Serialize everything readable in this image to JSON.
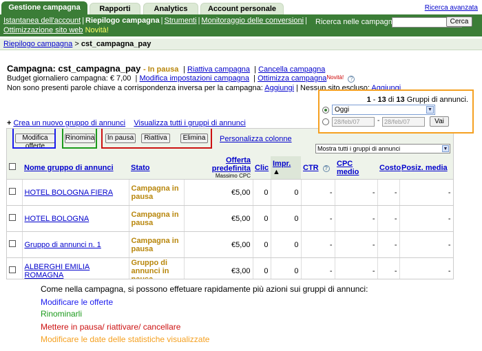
{
  "tabs": [
    {
      "label": "Gestione campagna",
      "active": true
    },
    {
      "label": "Rapporti",
      "active": false
    },
    {
      "label": "Analytics",
      "active": false
    },
    {
      "label": "Account personale",
      "active": false
    }
  ],
  "advanced_search": "Ricerca avanzata",
  "subnav": {
    "item1": "Istantanea dell'account",
    "item2": "Riepilogo campagna",
    "item3": "Strumenti",
    "item4": "Monitoraggio delle conversioni",
    "item5": "Ottimizzazione sito web",
    "new_badge": "Novità!"
  },
  "search": {
    "label": "Ricerca nelle campagne:",
    "value": "",
    "button": "Cerca"
  },
  "breadcrumb": {
    "link": "Riepilogo campagna",
    "separator": ">",
    "current": "cst_campagna_pay"
  },
  "campaign": {
    "title": "Campagna: cst_campagna_pay",
    "status": "- In pausa",
    "links": [
      "Riattiva campagna",
      "Cancella campagna"
    ],
    "budget_label": "Budget giornaliero campagna: € 7,00",
    "budget_links": [
      "Modifica impostazioni campagna",
      "Ottimizza campagna"
    ],
    "novita": "Novità!",
    "kw_text": "Non sono presenti parole chiave a corrispondenza inversa per la campagna:",
    "kw_link": "Aggiungi",
    "site_text": "Nessun sito escluso:",
    "site_link": "Aggiungi"
  },
  "create_links": {
    "plus": "+",
    "create": "Crea un nuovo gruppo di annunci",
    "view_all": "Visualizza tutti i gruppi di annunci"
  },
  "date_box": {
    "count_from": "1",
    "count_to": "13",
    "count_total": "13",
    "count_suffix": "Gruppi di annunci.",
    "range_selected": "Oggi",
    "date_from": "28/feb/07",
    "date_dash": "-",
    "date_to": "28/feb/07",
    "go_button": "Vai"
  },
  "toolbar": {
    "edit_bids": "Modifica offerte",
    "rename": "Rinomina",
    "pause": "In pausa",
    "resume": "Riattiva",
    "delete": "Elimina",
    "customize": "Personalizza colonne",
    "show_filter": "Mostra tutti i gruppi di annunci"
  },
  "columns": {
    "name": "Nome gruppo di annunci",
    "status": "Stato",
    "bid": "Offerta predefinita",
    "bid_sub": "Massimo CPC",
    "clicks": "Clic",
    "impr": "Impr.",
    "ctr": "CTR",
    "avg_cpc": "CPC medio",
    "cost": "Costo",
    "avg_pos": "Posiz. media"
  },
  "rows": [
    {
      "name": "HOTEL BOLOGNA FIERA",
      "status": "Campagna in pausa",
      "bid": "€5,00",
      "clicks": "0",
      "impr": "0",
      "ctr": "-",
      "cpc": "-",
      "cost": "-",
      "pos": "-"
    },
    {
      "name": "HOTEL BOLOGNA",
      "status": "Campagna in pausa",
      "bid": "€5,00",
      "clicks": "0",
      "impr": "0",
      "ctr": "-",
      "cpc": "-",
      "cost": "-",
      "pos": "-"
    },
    {
      "name": "Gruppo di annunci n. 1",
      "status": "Campagna in pausa",
      "bid": "€5,00",
      "clicks": "0",
      "impr": "0",
      "ctr": "-",
      "cpc": "-",
      "cost": "-",
      "pos": "-"
    },
    {
      "name": "ALBERGHI EMILIA ROMAGNA",
      "status": "Gruppo di annunci in pausa",
      "bid": "€3,00",
      "clicks": "0",
      "impr": "0",
      "ctr": "-",
      "cpc": "-",
      "cost": "-",
      "pos": "-"
    }
  ],
  "captions": [
    {
      "text": "Come nella campagna, si possono effetuare rapidamente più azioni sui gruppi di annunci:",
      "color": "#000000"
    },
    {
      "text": "Modificare le offerte",
      "color": "#1a1aee"
    },
    {
      "text": "Rinominarli",
      "color": "#1b9a1b"
    },
    {
      "text": "Mettere in pausa/ riattivare/ cancellare",
      "color": "#cc1111"
    },
    {
      "text": "Modificare le date delle statistiche visualizzate",
      "color": "#f5a020"
    }
  ],
  "colors": {
    "nav_green": "#3b7d37",
    "paused": "#b8860b",
    "link": "#0000cc"
  }
}
